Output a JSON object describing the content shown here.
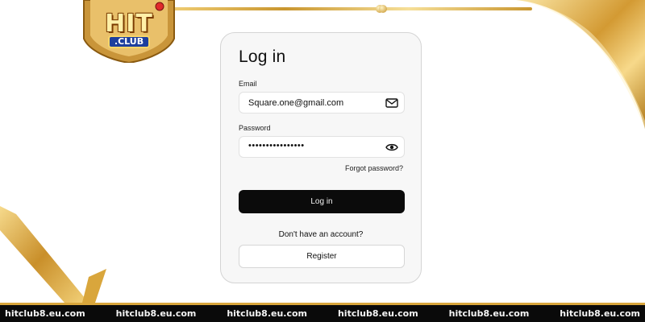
{
  "logo": {
    "text": "HIT",
    "sub": ".CLUB"
  },
  "login": {
    "title": "Log in",
    "email_label": "Email",
    "email_value": "Square.one@gmail.com",
    "password_label": "Password",
    "password_value": "••••••••••••••••",
    "forgot_password": "Forgot password?",
    "login_button": "Log in",
    "no_account": "Don't have an account?",
    "register_button": "Register"
  },
  "icons": {
    "email": "mail-icon",
    "password": "eye-icon"
  },
  "watermark": {
    "items": [
      "hitclub8.eu.com",
      "hitclub8.eu.com",
      "hitclub8.eu.com",
      "hitclub8.eu.com",
      "hitclub8.eu.com",
      "hitclub8.eu.com"
    ]
  },
  "colors": {
    "gold": "#d9a63c",
    "button": "#0b0b0b",
    "card": "#f7f7f7",
    "bar": "#0a0a0a"
  }
}
